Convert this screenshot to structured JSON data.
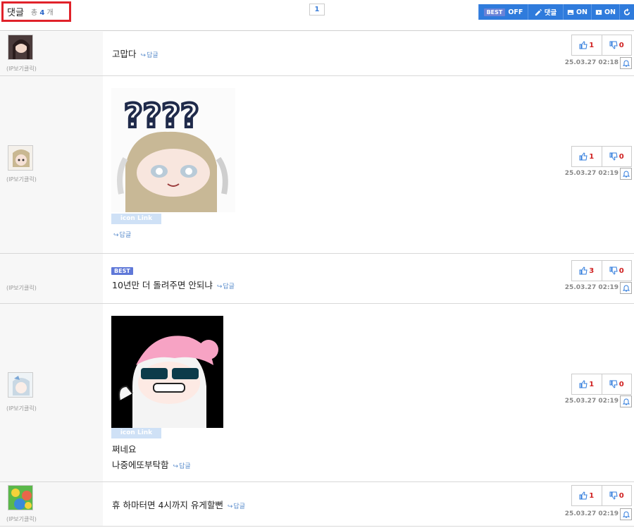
{
  "header": {
    "title": "댓글",
    "total_prefix": "총",
    "total_count": "4",
    "total_suffix": "개",
    "page": "1"
  },
  "toolbar": {
    "best_tag": "BEST",
    "best_state": "OFF",
    "comment_label": "댓글",
    "image_state": "ON",
    "video_state": "ON"
  },
  "comments": [
    {
      "ip": "(IP보기클릭)",
      "text": "고맙다",
      "reply": "답글",
      "up": "1",
      "down": "0",
      "date": "25.03.27 02:18"
    },
    {
      "ip": "(IP보기클릭)",
      "icon_link": "icon Link",
      "reply": "답글",
      "up": "1",
      "down": "0",
      "date": "25.03.27 02:19"
    },
    {
      "ip": "(IP보기클릭)",
      "best": "BEST",
      "text": "10년만 더 돌려주면 안되냐",
      "reply": "답글",
      "up": "3",
      "down": "0",
      "date": "25.03.27 02:19"
    },
    {
      "ip": "(IP보기클릭)",
      "icon_link": "icon Link",
      "text": "쩌네요",
      "text2": "나중에또부탁함",
      "reply": "답글",
      "up": "1",
      "down": "0",
      "date": "25.03.27 02:19"
    },
    {
      "ip": "(IP보기클릭)",
      "text": "휴 하마터면 4시까지 유게할뻔",
      "reply": "답글",
      "up": "1",
      "down": "0",
      "date": "25.03.27 02:19"
    }
  ],
  "colors": {
    "accent": "#2f7bdc",
    "highlight": "#e0222a",
    "up": "#2f7bdc",
    "down": "#d02020"
  },
  "icons": [
    "thumbs-up-icon",
    "thumbs-down-icon",
    "bell-icon",
    "pencil-icon",
    "image-icon",
    "video-icon",
    "refresh-icon"
  ]
}
